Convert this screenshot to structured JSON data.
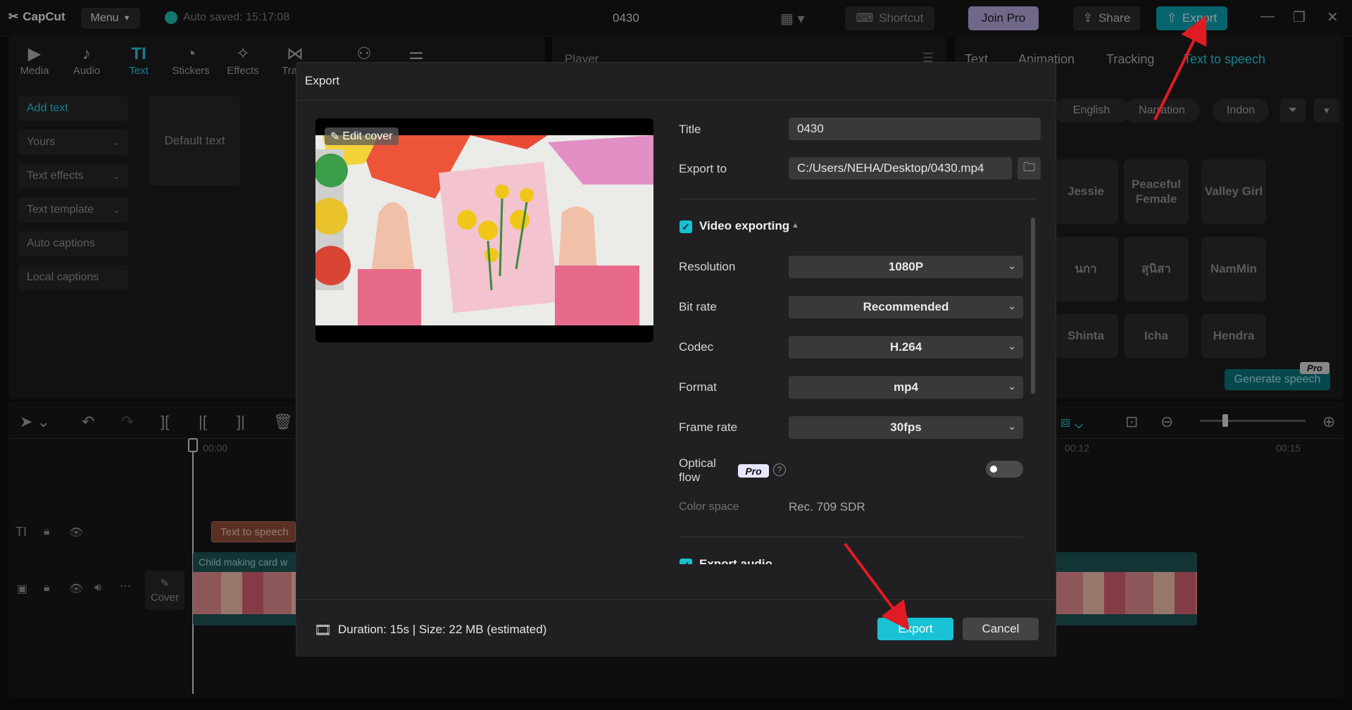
{
  "app": {
    "logo": "CapCut",
    "menu_label": "Menu",
    "autosave": "Auto saved: 15:17:08",
    "project_title": "0430"
  },
  "topbar": {
    "shortcut": "Shortcut",
    "join_pro": "Join Pro",
    "share": "Share",
    "export": "Export"
  },
  "toolbar": {
    "items": [
      {
        "label": "Media",
        "icon": "media-icon"
      },
      {
        "label": "Audio",
        "icon": "audio-icon"
      },
      {
        "label": "Text",
        "icon": "text-icon",
        "active": true
      },
      {
        "label": "Stickers",
        "icon": "stickers-icon"
      },
      {
        "label": "Effects",
        "icon": "effects-icon"
      },
      {
        "label": "Trans",
        "icon": "transitions-icon"
      }
    ]
  },
  "text_sidebar": {
    "items": [
      "Add text",
      "Yours",
      "Text effects",
      "Text template",
      "Auto captions",
      "Local captions"
    ]
  },
  "default_text": "Default text",
  "player": {
    "title": "Player"
  },
  "right_panel": {
    "tabs": [
      "Text",
      "Animation",
      "Tracking",
      "Text to speech"
    ],
    "chips": [
      "English",
      "Narration",
      "Indon"
    ],
    "voices": [
      "Jessie",
      "Peaceful Female",
      "Valley Girl",
      "นกา",
      "สุนิสา",
      "NamMin",
      "Shinta",
      "Icha",
      "Hendra"
    ],
    "generate_speech": "Generate speech",
    "pro_badge": "Pro"
  },
  "timeline": {
    "time_start": "00:00",
    "time_12": "00:12",
    "time_15": "00:15",
    "text_clip": "Text to speech",
    "video_clip": "Child making card w",
    "cover": "Cover"
  },
  "dialog": {
    "title": "Export",
    "edit_cover": "Edit cover",
    "fields": {
      "title_label": "Title",
      "title_value": "0430",
      "export_to_label": "Export to",
      "export_to_value": "C:/Users/NEHA/Desktop/0430.mp4"
    },
    "video_exporting": "Video exporting",
    "resolution_label": "Resolution",
    "resolution_value": "1080P",
    "bitrate_label": "Bit rate",
    "bitrate_value": "Recommended",
    "codec_label": "Codec",
    "codec_value": "H.264",
    "format_label": "Format",
    "format_value": "mp4",
    "framerate_label": "Frame rate",
    "framerate_value": "30fps",
    "optical_flow_label_1": "Optical",
    "optical_flow_label_2": "flow",
    "pro_label": "Pro",
    "color_space_label": "Color space",
    "color_space_value": "Rec. 709 SDR",
    "export_audio": "Export audio",
    "duration_text": "Duration: 15s | Size: 22 MB (estimated)",
    "export_button": "Export",
    "cancel_button": "Cancel"
  },
  "colors": {
    "accent": "#18c2d4",
    "annotation": "#e01b24"
  }
}
